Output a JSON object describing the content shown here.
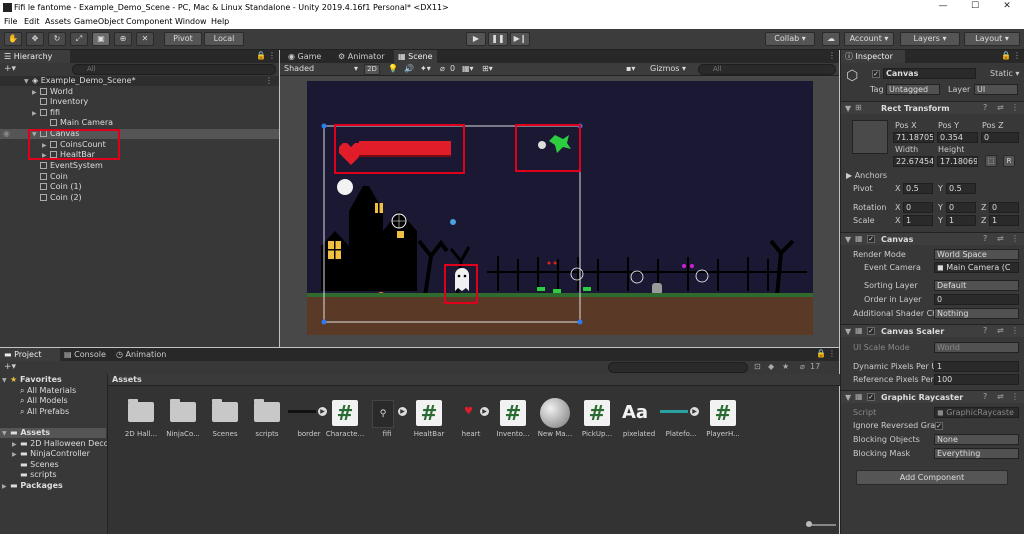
{
  "window": {
    "title": "Fifi le fantome - Example_Demo_Scene - PC, Mac & Linux Standalone - Unity 2019.4.16f1 Personal* <DX11>",
    "min": "—",
    "max": "☐",
    "close": "✕"
  },
  "menu": [
    "File",
    "Edit",
    "Assets",
    "GameObject",
    "Component",
    "Window",
    "Help"
  ],
  "toolbar": {
    "pivot": "Pivot",
    "local": "Local",
    "collab": "Collab ▾",
    "account": "Account ▾",
    "layers": "Layers ▾",
    "layout": "Layout ▾"
  },
  "hierarchy": {
    "tab": "Hierarchy",
    "search_placeholder": "All",
    "scene": "Example_Demo_Scene*",
    "items": [
      "World",
      "Inventory",
      "fifi",
      "Main Camera",
      "Canvas",
      "CoinsCount",
      "HealtBar",
      "EventSystem",
      "Coin",
      "Coin (1)",
      "Coin (2)"
    ]
  },
  "scene_tabs": {
    "game": "Game",
    "animator": "Animator",
    "scene": "Scene",
    "shading": "Shaded",
    "mode2d": "2D",
    "gizmos": "Gizmos",
    "search_placeholder": "All",
    "hidden_count": "0"
  },
  "bottom_tabs": {
    "project": "Project",
    "console": "Console",
    "animation": "Animation",
    "hidden_count": "17"
  },
  "project_tree": {
    "favorites": "Favorites",
    "fav_items": [
      "All Materials",
      "All Models",
      "All Prefabs"
    ],
    "assets": "Assets",
    "asset_items": [
      "2D Halloween Decc",
      "NinjaController",
      "Scenes",
      "scripts"
    ],
    "packages": "Packages"
  },
  "assets_panel": {
    "breadcrumb": "Assets",
    "items": [
      {
        "label": "2D Hall...",
        "kind": "folder"
      },
      {
        "label": "NinjaCo...",
        "kind": "folder"
      },
      {
        "label": "Scenes",
        "kind": "folder"
      },
      {
        "label": "scripts",
        "kind": "folder"
      },
      {
        "label": "border",
        "kind": "sprite"
      },
      {
        "label": "Characte...",
        "kind": "script"
      },
      {
        "label": "fifi",
        "kind": "sprite"
      },
      {
        "label": "HealtBar",
        "kind": "script"
      },
      {
        "label": "heart",
        "kind": "sprite"
      },
      {
        "label": "Invento...",
        "kind": "script"
      },
      {
        "label": "New Ma...",
        "kind": "material"
      },
      {
        "label": "PickUp...",
        "kind": "script"
      },
      {
        "label": "pixelated",
        "kind": "font"
      },
      {
        "label": "Platefo...",
        "kind": "sprite"
      },
      {
        "label": "PlayerH...",
        "kind": "script"
      }
    ],
    "script_glyph": "#",
    "font_glyph": "Aa"
  },
  "inspector": {
    "tab": "Inspector",
    "object_name": "Canvas",
    "static_label": "Static",
    "tag_label": "Tag",
    "tag_value": "Untagged",
    "layer_label": "Layer",
    "layer_value": "UI",
    "rect_transform": {
      "title": "Rect Transform",
      "posx_label": "Pos X",
      "posy_label": "Pos Y",
      "posz_label": "Pos Z",
      "posx": "71.18705",
      "posy": "0.354",
      "posz": "0",
      "width_label": "Width",
      "height_label": "Height",
      "width": "22.67454",
      "height": "17.18069",
      "anchors": "Anchors",
      "pivot_label": "Pivot",
      "pivot_x": "0.5",
      "pivot_y": "0.5",
      "rotation_label": "Rotation",
      "rot_x": "0",
      "rot_y": "0",
      "rot_z": "0",
      "scale_label": "Scale",
      "scale_x": "1",
      "scale_y": "1",
      "scale_z": "1",
      "x": "X",
      "y": "Y",
      "z": "Z",
      "r_btn": "R"
    },
    "canvas": {
      "title": "Canvas",
      "render_mode_label": "Render Mode",
      "render_mode": "World Space",
      "event_camera_label": "Event Camera",
      "event_camera": "Main Camera (C",
      "sorting_layer_label": "Sorting Layer",
      "sorting_layer": "Default",
      "order_label": "Order in Layer",
      "order": "0",
      "shader_label": "Additional Shader Ch",
      "shader": "Nothing"
    },
    "canvas_scaler": {
      "title": "Canvas Scaler",
      "ui_scale_label": "UI Scale Mode",
      "ui_scale": "World",
      "dpp_label": "Dynamic Pixels Per U",
      "dpp": "1",
      "ref_label": "Reference Pixels Per",
      "ref": "100"
    },
    "graphic_raycaster": {
      "title": "Graphic Raycaster",
      "script_label": "Script",
      "script": "GraphicRaycaste",
      "ignore_label": "Ignore Reversed Grap",
      "blocking_objects_label": "Blocking Objects",
      "blocking_objects": "None",
      "blocking_mask_label": "Blocking Mask",
      "blocking_mask": "Everything"
    },
    "add_component": "Add Component"
  }
}
